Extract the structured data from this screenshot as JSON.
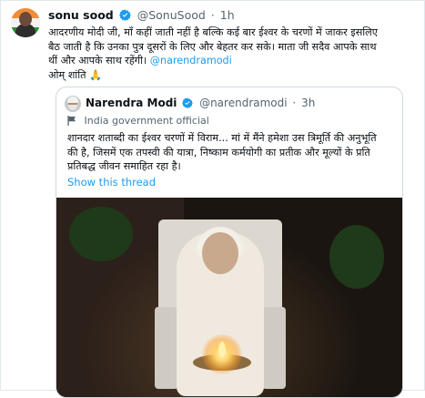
{
  "tweet": {
    "author_name": "sonu sood",
    "author_handle": "@SonuSood",
    "time": "1h",
    "text_lines": [
      "आदरणीय मोदी जी, माँ कहीं जाती नहीं है बल्कि कई बार ईश्वर के चरणों में जाकर इसलिए",
      "बैठ जाती है कि उनका पुत्र दूसरों के लिए और बेहतर कर सके। माता जी सदैव आपके साथ",
      "थीं और आपके साथ रहेंगी।",
      "ओम् शांति 🙏"
    ],
    "mention": "@narendramodi"
  },
  "quoted": {
    "author_name": "Narendra Modi",
    "author_handle": "@narendramodi",
    "time": "3h",
    "label": "India government official",
    "text_lines": [
      "शानदार शताब्दी का ईश्वर चरणों में विराम... मां में मैंने हमेशा उस त्रिमूर्ति की अनुभूति",
      "की है, जिसमें एक तपस्वी की यात्रा, निष्काम कर्मयोगी का प्रतीक और मूल्यों के प्रति",
      "प्रतिबद्ध जीवन समाहित रहा है।"
    ],
    "show_thread": "Show this thread"
  },
  "colors": {
    "link": "#1d9bf0",
    "verified": "#1d9bf0",
    "muted": "#536471"
  }
}
